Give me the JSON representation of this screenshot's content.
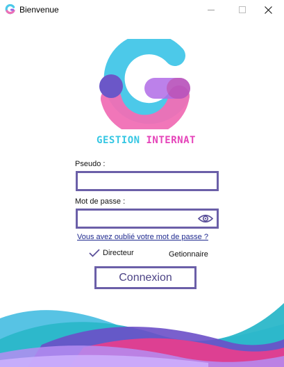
{
  "window": {
    "title": "Bienvenue"
  },
  "brand": {
    "word1": "GESTION",
    "word2": "INTERNAT"
  },
  "form": {
    "pseudo_label": "Pseudo :",
    "pseudo_value": "",
    "password_label": "Mot de passe :",
    "password_value": "",
    "forgot_link": "Vous avez oublié votre mot de passe ?",
    "role_director": "Directeur",
    "role_manager": "Getionnaire",
    "selected_role": "Directeur",
    "submit_label": "Connexion"
  },
  "colors": {
    "accent_border": "#6b5fa8",
    "logo_cyan": "#4cc9e9",
    "logo_pink": "#f06fb5",
    "logo_purple": "#6b57c8",
    "brand_cyan": "#36c7e3",
    "brand_magenta": "#e543b9"
  },
  "icons": {
    "app": "g-logo-icon",
    "minimize": "minimize-icon",
    "maximize": "maximize-icon",
    "close": "close-icon",
    "show_password": "eye-icon",
    "selected_role": "checkmark-icon"
  }
}
